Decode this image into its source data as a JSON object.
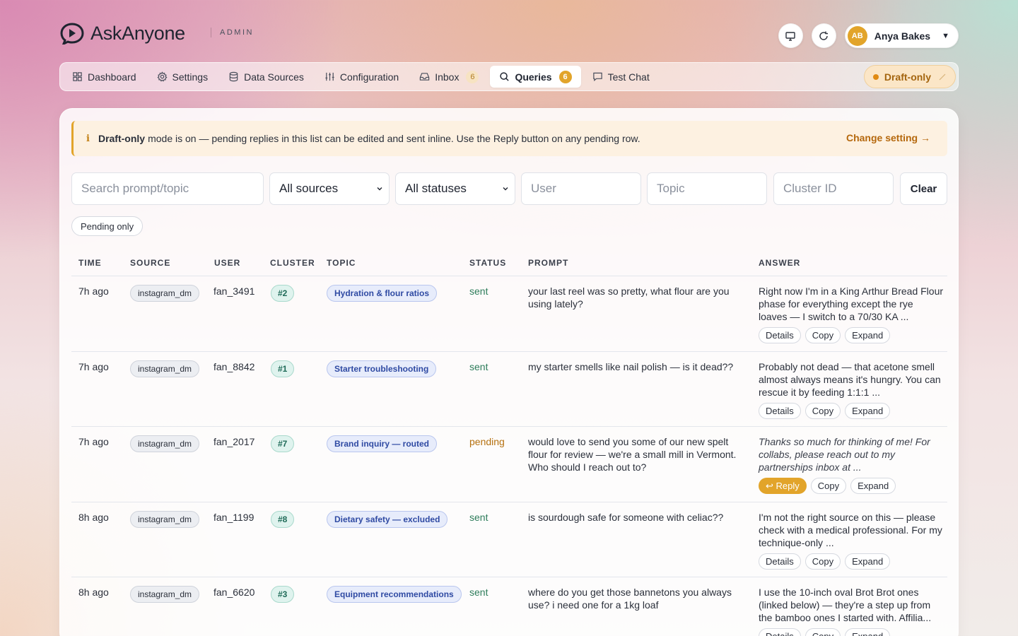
{
  "app": {
    "name": "AskAnyone",
    "section_tag": "ADMIN"
  },
  "user": {
    "initials": "AB",
    "name": "Anya Bakes"
  },
  "nav": {
    "items": [
      {
        "label": "Dashboard"
      },
      {
        "label": "Settings"
      },
      {
        "label": "Data Sources"
      },
      {
        "label": "Configuration"
      },
      {
        "label": "Inbox",
        "count": "6"
      },
      {
        "label": "Queries",
        "count": "6"
      },
      {
        "label": "Test Chat"
      }
    ],
    "active": "Queries",
    "mode_label": "Draft-only"
  },
  "notice": {
    "bold": "Draft-only",
    "text": "mode is on — pending replies in this list can be edited and sent inline. Use the Reply button on any pending row.",
    "link": "Change setting →"
  },
  "filters": {
    "search_placeholder": "Search prompt/topic",
    "source_value": "All sources",
    "status_value": "All statuses",
    "user_placeholder": "User",
    "topic_placeholder": "Topic",
    "cluster_placeholder": "Cluster ID",
    "clear_label": "Clear",
    "pending_only_label": "Pending only"
  },
  "table": {
    "columns": [
      "TIME",
      "SOURCE",
      "USER",
      "CLUSTER",
      "TOPIC",
      "STATUS",
      "PROMPT",
      "ANSWER"
    ],
    "rows": [
      {
        "time": "7h ago",
        "source": "instagram_dm",
        "user": "fan_3491",
        "cluster": "#2",
        "topic": "Hydration & flour ratios",
        "status": "sent",
        "prompt": "your last reel was so pretty, what flour are you using lately?",
        "answer": "Right now I'm in a King Arthur Bread Flour phase for everything except the rye loaves — I switch to a 70/30 KA ...",
        "actions": [
          "Details",
          "Copy",
          "Expand"
        ]
      },
      {
        "time": "7h ago",
        "source": "instagram_dm",
        "user": "fan_8842",
        "cluster": "#1",
        "topic": "Starter troubleshooting",
        "status": "sent",
        "prompt": "my starter smells like nail polish — is it dead??",
        "answer": "Probably not dead — that acetone smell almost always means it's hungry. You can rescue it by feeding 1:1:1 ...",
        "actions": [
          "Details",
          "Copy",
          "Expand"
        ]
      },
      {
        "time": "7h ago",
        "source": "instagram_dm",
        "user": "fan_2017",
        "cluster": "#7",
        "topic": "Brand inquiry — routed",
        "status": "pending",
        "prompt": "would love to send you some of our new spelt flour for review — we're a small mill in Vermont. Who should I reach out to?",
        "answer": "Thanks so much for thinking of me! For collabs, please reach out to my partnerships inbox at ...",
        "actions": [
          "↩ Reply",
          "Copy",
          "Expand"
        ]
      },
      {
        "time": "8h ago",
        "source": "instagram_dm",
        "user": "fan_1199",
        "cluster": "#8",
        "topic": "Dietary safety — excluded",
        "status": "sent",
        "prompt": "is sourdough safe for someone with celiac??",
        "answer": "I'm not the right source on this — please check with a medical professional. For my technique-only ...",
        "actions": [
          "Details",
          "Copy",
          "Expand"
        ]
      },
      {
        "time": "8h ago",
        "source": "instagram_dm",
        "user": "fan_6620",
        "cluster": "#3",
        "topic": "Equipment recommendations",
        "status": "sent",
        "prompt": "where do you get those bannetons you always use? i need one for a 1kg loaf",
        "answer": "I use the 10-inch oval Brot Brot ones (linked below) — they're a step up from the bamboo ones I started with. Affilia...",
        "actions": [
          "Details",
          "Copy",
          "Expand"
        ]
      }
    ]
  }
}
